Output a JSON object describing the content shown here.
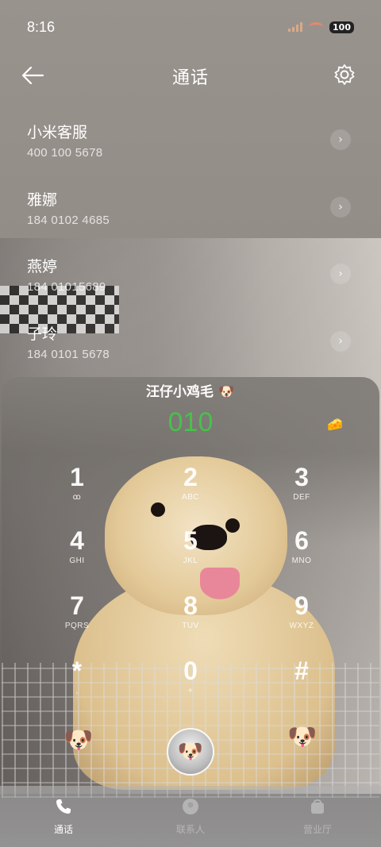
{
  "status_bar": {
    "time": "8:16",
    "battery": "100"
  },
  "header": {
    "title": "通话"
  },
  "contacts": [
    {
      "name": "小米客服",
      "number": "400 100 5678"
    },
    {
      "name": "雅娜",
      "number": "184 0102 4685"
    },
    {
      "name": "燕婷",
      "number": "184 01015689"
    },
    {
      "name": "子玲",
      "number": "184 0101 5678"
    }
  ],
  "dialer": {
    "title": "汪仔小鸡毛",
    "input": "010",
    "keys": [
      {
        "digit": "1",
        "letters": "ꝏ"
      },
      {
        "digit": "2",
        "letters": "ABC"
      },
      {
        "digit": "3",
        "letters": "DEF"
      },
      {
        "digit": "4",
        "letters": "GHI"
      },
      {
        "digit": "5",
        "letters": "JKL"
      },
      {
        "digit": "6",
        "letters": "MNO"
      },
      {
        "digit": "7",
        "letters": "PQRS"
      },
      {
        "digit": "8",
        "letters": "TUV"
      },
      {
        "digit": "9",
        "letters": "WXYZ"
      },
      {
        "digit": "*",
        "letters": ","
      },
      {
        "digit": "0",
        "letters": "+"
      },
      {
        "digit": "#",
        "letters": ""
      }
    ]
  },
  "tabs": [
    {
      "label": "通话",
      "icon": "phone-icon",
      "active": true
    },
    {
      "label": "联系人",
      "icon": "contacts-icon",
      "active": false
    },
    {
      "label": "营业厅",
      "icon": "store-icon",
      "active": false
    }
  ],
  "colors": {
    "dial_input": "#46c24a",
    "background": "#8d8883"
  }
}
